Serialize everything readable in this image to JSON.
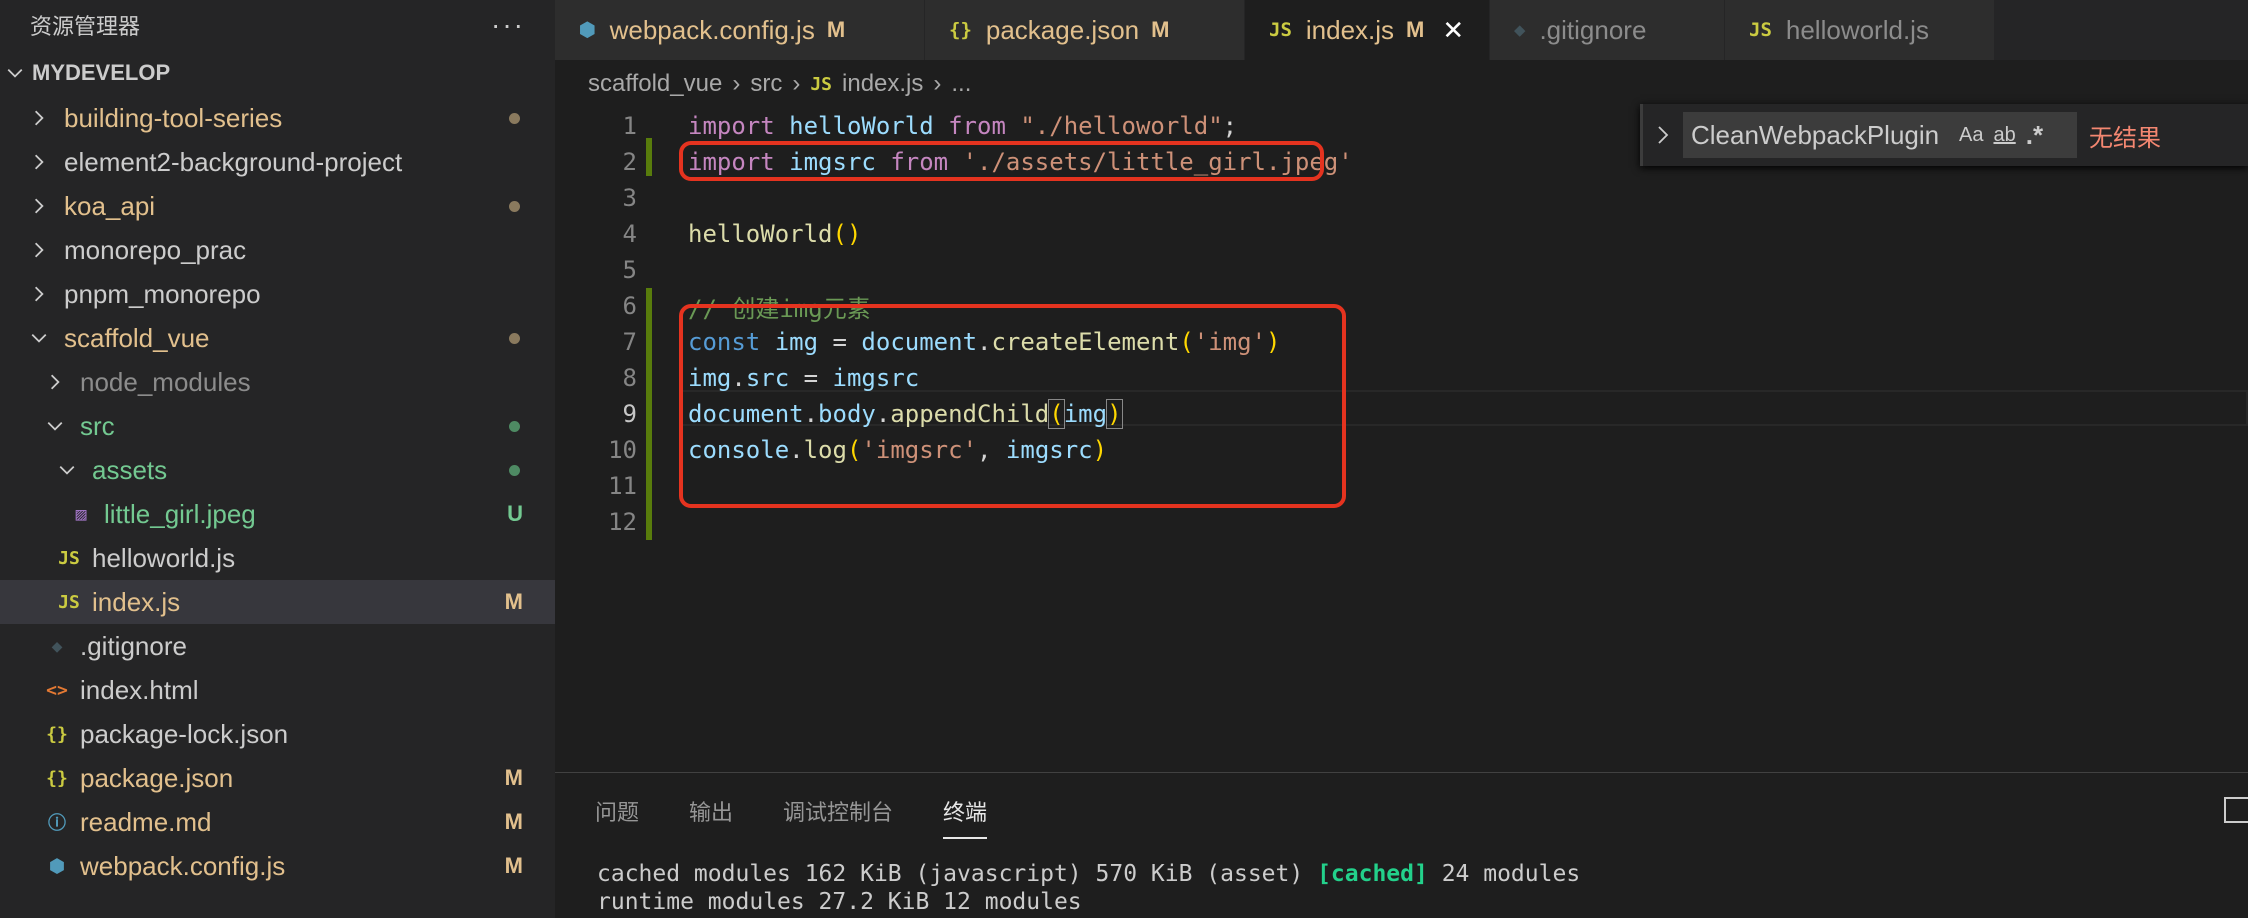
{
  "sidebar": {
    "title": "资源管理器",
    "more": "···",
    "root": "MYDEVELOP",
    "items": [
      {
        "label": "building-tool-series",
        "kind": "folder",
        "expanded": false,
        "depth": 0,
        "color": "#e2c08d",
        "status": "dot-modified"
      },
      {
        "label": "element2-background-project",
        "kind": "folder",
        "expanded": false,
        "depth": 0,
        "color": "#cccccc",
        "status": ""
      },
      {
        "label": "koa_api",
        "kind": "folder",
        "expanded": false,
        "depth": 0,
        "color": "#e2c08d",
        "status": "dot-modified"
      },
      {
        "label": "monorepo_prac",
        "kind": "folder",
        "expanded": false,
        "depth": 0,
        "color": "#cccccc",
        "status": ""
      },
      {
        "label": "pnpm_monorepo",
        "kind": "folder",
        "expanded": false,
        "depth": 0,
        "color": "#cccccc",
        "status": ""
      },
      {
        "label": "scaffold_vue",
        "kind": "folder",
        "expanded": true,
        "depth": 0,
        "color": "#e2c08d",
        "status": "dot-modified"
      },
      {
        "label": "node_modules",
        "kind": "folder",
        "expanded": false,
        "depth": 1,
        "color": "#8c8c8c",
        "status": ""
      },
      {
        "label": "src",
        "kind": "folder",
        "expanded": true,
        "depth": 1,
        "color": "#73c991",
        "status": "dot-untracked"
      },
      {
        "label": "assets",
        "kind": "folder",
        "expanded": true,
        "depth": 2,
        "color": "#73c991",
        "status": "dot-untracked"
      },
      {
        "label": "little_girl.jpeg",
        "kind": "image",
        "depth": 3,
        "color": "#73c991",
        "status": "U"
      },
      {
        "label": "helloworld.js",
        "kind": "js",
        "depth": 2,
        "color": "#cccccc",
        "status": ""
      },
      {
        "label": "index.js",
        "kind": "js",
        "depth": 2,
        "color": "#e2c08d",
        "status": "M",
        "selected": true
      },
      {
        "label": ".gitignore",
        "kind": "git",
        "depth": 1,
        "color": "#cccccc",
        "status": ""
      },
      {
        "label": "index.html",
        "kind": "html",
        "depth": 1,
        "color": "#cccccc",
        "status": ""
      },
      {
        "label": "package-lock.json",
        "kind": "json",
        "depth": 1,
        "color": "#cccccc",
        "status": ""
      },
      {
        "label": "package.json",
        "kind": "json",
        "depth": 1,
        "color": "#e2c08d",
        "status": "M"
      },
      {
        "label": "readme.md",
        "kind": "info",
        "depth": 1,
        "color": "#e2c08d",
        "status": "M"
      },
      {
        "label": "webpack.config.js",
        "kind": "webpack",
        "depth": 1,
        "color": "#e2c08d",
        "status": "M"
      }
    ]
  },
  "tabs": [
    {
      "label": "webpack.config.js",
      "icon": "webpack-icon",
      "status": "M",
      "active": false,
      "color": "#e2c08d"
    },
    {
      "label": "package.json",
      "icon": "json-icon",
      "status": "M",
      "active": false,
      "color": "#e2c08d"
    },
    {
      "label": "index.js",
      "icon": "js-icon",
      "status": "M",
      "active": true,
      "color": "#e2c08d",
      "close": "✕"
    },
    {
      "label": ".gitignore",
      "icon": "git-icon",
      "status": "",
      "active": false,
      "color": "#8c8c8c"
    },
    {
      "label": "helloworld.js",
      "icon": "js-icon",
      "status": "",
      "active": false,
      "color": "#8c8c8c"
    }
  ],
  "breadcrumb": {
    "parts": [
      "scaffold_vue",
      "src",
      "index.js",
      "..."
    ],
    "sep": "›"
  },
  "editor": {
    "lines": [
      {
        "n": "1",
        "tokens": [
          [
            "kw",
            "import"
          ],
          [
            "pl",
            " "
          ],
          [
            "var",
            "helloWorld"
          ],
          [
            "pl",
            " "
          ],
          [
            "kw",
            "from"
          ],
          [
            "pl",
            " "
          ],
          [
            "str",
            "\"./helloworld\""
          ],
          [
            "pl",
            ";"
          ]
        ]
      },
      {
        "n": "2",
        "tokens": [
          [
            "kw",
            "import"
          ],
          [
            "pl",
            " "
          ],
          [
            "var",
            "imgsrc"
          ],
          [
            "pl",
            " "
          ],
          [
            "kw",
            "from"
          ],
          [
            "pl",
            " "
          ],
          [
            "str",
            "'./assets/little_girl.jpeg'"
          ]
        ]
      },
      {
        "n": "3",
        "tokens": []
      },
      {
        "n": "4",
        "tokens": [
          [
            "fn",
            "helloWorld"
          ],
          [
            "br",
            "()"
          ]
        ]
      },
      {
        "n": "5",
        "tokens": []
      },
      {
        "n": "6",
        "tokens": [
          [
            "cm",
            "// 创建img元素"
          ]
        ]
      },
      {
        "n": "7",
        "tokens": [
          [
            "kw2",
            "const"
          ],
          [
            "pl",
            " "
          ],
          [
            "var",
            "img"
          ],
          [
            "pl",
            " = "
          ],
          [
            "var",
            "document"
          ],
          [
            "pl",
            "."
          ],
          [
            "fn",
            "createElement"
          ],
          [
            "br",
            "("
          ],
          [
            "str",
            "'img'"
          ],
          [
            "br",
            ")"
          ]
        ]
      },
      {
        "n": "8",
        "tokens": [
          [
            "var",
            "img"
          ],
          [
            "pl",
            "."
          ],
          [
            "var",
            "src"
          ],
          [
            "pl",
            " = "
          ],
          [
            "var",
            "imgsrc"
          ]
        ]
      },
      {
        "n": "9",
        "tokens": [
          [
            "var",
            "document"
          ],
          [
            "pl",
            "."
          ],
          [
            "var",
            "body"
          ],
          [
            "pl",
            "."
          ],
          [
            "fn",
            "appendChild"
          ],
          [
            "brm",
            "("
          ],
          [
            "var",
            "img"
          ],
          [
            "brm",
            ")"
          ]
        ]
      },
      {
        "n": "10",
        "tokens": [
          [
            "var",
            "console"
          ],
          [
            "pl",
            "."
          ],
          [
            "fn",
            "log"
          ],
          [
            "br",
            "("
          ],
          [
            "str",
            "'imgsrc'"
          ],
          [
            "pl",
            ", "
          ],
          [
            "var",
            "imgsrc"
          ],
          [
            "br",
            ")"
          ]
        ]
      },
      {
        "n": "11",
        "tokens": []
      },
      {
        "n": "12",
        "tokens": []
      }
    ],
    "current_line": "9"
  },
  "find": {
    "value": "CleanWebpackPlugin",
    "match_case": "Aa",
    "whole_word": "ab",
    "regex": ".*",
    "result": "无结果"
  },
  "panel": {
    "tabs": [
      "问题",
      "输出",
      "调试控制台",
      "终端"
    ],
    "active_tab": "终端",
    "terminal": {
      "line1_pre": "cached modules 162 KiB (javascript) 570 KiB (asset) ",
      "line1_hl": "[cached]",
      "line1_post": " 24 modules",
      "line2": "runtime modules 27.2 KiB 12 modules"
    }
  },
  "colors": {
    "annotation": "#e5331f",
    "modified": "#e2c08d",
    "untracked": "#73c991"
  }
}
